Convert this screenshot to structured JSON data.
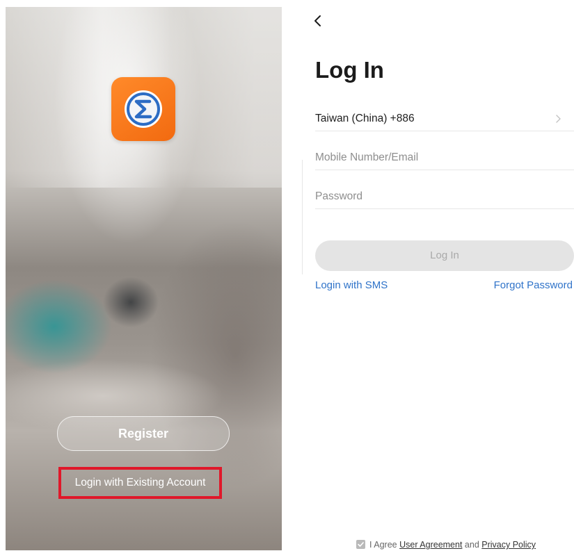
{
  "welcome": {
    "app_icon": "sigma-circle-logo",
    "register_label": "Register",
    "existing_account_label": "Login with Existing Account",
    "highlight_color": "#e0182a",
    "brand_color": "#f26a10"
  },
  "login": {
    "back_icon": "chevron-left-icon",
    "title": "Log In",
    "country_value": "Taiwan (China) +886",
    "country_chevron_icon": "chevron-right-icon",
    "account_placeholder": "Mobile Number/Email",
    "password_placeholder": "Password",
    "login_button_label": "Log In",
    "sms_link": "Login with SMS",
    "forgot_link": "Forgot Password",
    "link_color": "#2f73c9",
    "agreement": {
      "checkbox_icon": "checkbox-checked-icon",
      "prefix": "I Agree",
      "user_agreement": "User Agreement",
      "and": "and",
      "privacy_policy": "Privacy Policy"
    }
  }
}
